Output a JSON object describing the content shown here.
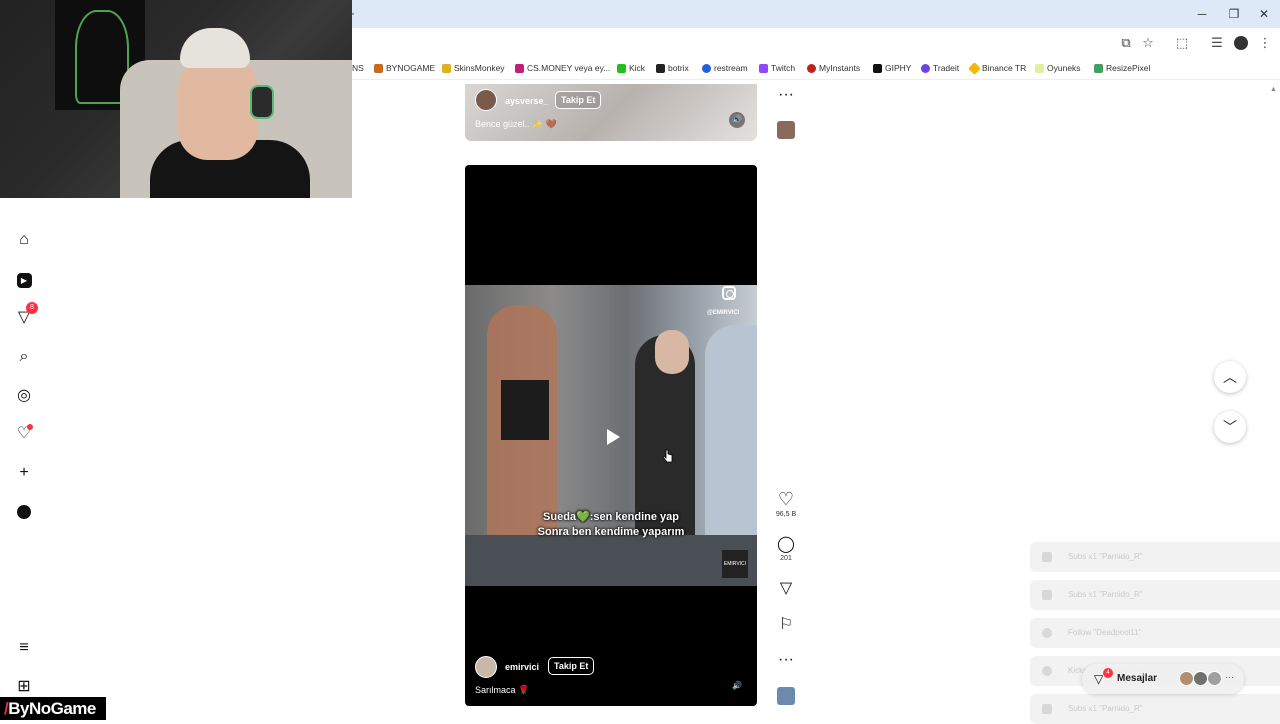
{
  "browser": {
    "new_tab": "+",
    "window_controls": {
      "minimize": "─",
      "maximize": "❐",
      "close": "✕"
    },
    "toolbar_icons": [
      "screen-cast-icon",
      "star-icon",
      "extensions-icon",
      "media-icon",
      "more-icon"
    ],
    "bookmarks": [
      {
        "label": "NS",
        "color": "#ffffff"
      },
      {
        "label": "BYNOGAME",
        "color": "#c96b1e"
      },
      {
        "label": "SkinsMonkey",
        "color": "#e0b020"
      },
      {
        "label": "CS.MONEY veya ey...",
        "color": "#c0207a"
      },
      {
        "label": "Kick",
        "color": "#20c020"
      },
      {
        "label": "botrix",
        "color": "#222222"
      },
      {
        "label": "restream",
        "color": "#2060e0"
      },
      {
        "label": "Twitch",
        "color": "#9146ff"
      },
      {
        "label": "MyInstants",
        "color": "#c02020"
      },
      {
        "label": "GIPHY",
        "color": "#111111"
      },
      {
        "label": "Tradeit",
        "color": "#7040e0"
      },
      {
        "label": "Binance TR",
        "color": "#f0b90b"
      },
      {
        "label": "Oyuneks",
        "color": "#e0f0a0"
      },
      {
        "label": "ResizePixel",
        "color": "#40a060"
      }
    ]
  },
  "nav": {
    "items": [
      {
        "name": "home",
        "glyph": "⌂"
      },
      {
        "name": "reels",
        "glyph": "▶"
      },
      {
        "name": "direct",
        "glyph": "▽",
        "badge": "8"
      },
      {
        "name": "search",
        "glyph": "⌕"
      },
      {
        "name": "explore",
        "glyph": "◎"
      },
      {
        "name": "notifications",
        "glyph": "♡"
      },
      {
        "name": "create",
        "glyph": "+"
      }
    ],
    "menu_glyph": "≡",
    "more_glyph": "⊞"
  },
  "brand": {
    "prefix": "/",
    "name": "ByNoGame"
  },
  "post1": {
    "username": "aysverse_",
    "follow": "Takip Et",
    "caption": "Bence güzel.. ✨ 🤎",
    "sound": "🔊"
  },
  "post2": {
    "watermark": "@EMIRVICI",
    "subtitle_line1": "Sueda💚:sen kendine yap",
    "subtitle_line2": "Sonra ben kendime yaparım",
    "logo_text": "EMIRVICI",
    "username": "emirvici",
    "follow": "Takip Et",
    "caption": "Sarılmaca 🌹",
    "sound": "🔊"
  },
  "actions": {
    "more": "···",
    "like": "♡",
    "likes_count": "96,5 B",
    "comment": "◯",
    "comments_count": "201",
    "share": "▽",
    "save": "⚐"
  },
  "scroll": {
    "up": "︿",
    "down": "﹀"
  },
  "alerts": [
    "Subs x1 \"Parnido_R\"",
    "Subs x1 \"Parnido_R\"",
    "Follow \"Deadpool11\"",
    "Kicks x1 \"Yaymail_34\"",
    "Subs x1 \"Parnido_R\""
  ],
  "messages": {
    "label": "Mesajlar",
    "badge": "4",
    "more": "···"
  }
}
